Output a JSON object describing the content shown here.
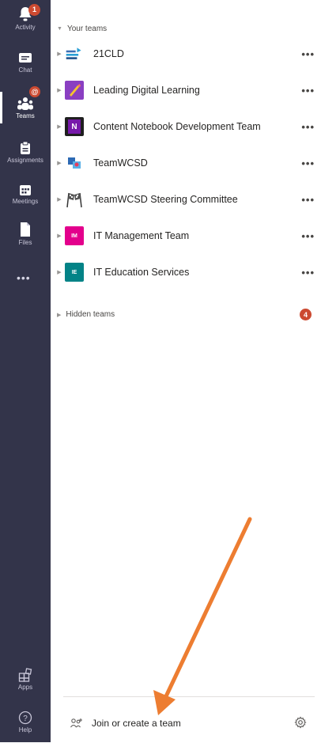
{
  "rail": {
    "items": [
      {
        "label": "Activity",
        "icon": "bell-icon",
        "badge": "1"
      },
      {
        "label": "Chat",
        "icon": "chat-icon"
      },
      {
        "label": "Teams",
        "icon": "teams-icon",
        "badge": "@",
        "active": true
      },
      {
        "label": "Assignments",
        "icon": "assignments-icon"
      },
      {
        "label": "Meetings",
        "icon": "calendar-icon"
      },
      {
        "label": "Files",
        "icon": "file-icon"
      },
      {
        "label": "Apps",
        "icon": "apps-icon"
      },
      {
        "label": "Help",
        "icon": "help-icon"
      }
    ],
    "more": "•••"
  },
  "your_teams": {
    "header": "Your teams",
    "teams": [
      {
        "name": "21CLD",
        "icon_text": "",
        "icon_color": "#3a6fb5"
      },
      {
        "name": "Leading Digital Learning",
        "icon_text": "",
        "icon_color": "#8a3fc2"
      },
      {
        "name": "Content Notebook Development Team",
        "icon_text": "N",
        "icon_color": "#7719aa"
      },
      {
        "name": "TeamWCSD",
        "icon_text": "",
        "icon_color": "#2d6ab4"
      },
      {
        "name": "TeamWCSD Steering Committee",
        "icon_text": "",
        "icon_color": "#555555"
      },
      {
        "name": "IT Management Team",
        "icon_text": "IM",
        "icon_color": "#e3008c"
      },
      {
        "name": "IT Education Services",
        "icon_text": "IE",
        "icon_color": "#038387"
      }
    ],
    "more_label": "•••"
  },
  "hidden_teams": {
    "label": "Hidden teams",
    "count": "4"
  },
  "footer": {
    "join_label": "Join or create a team"
  },
  "colors": {
    "rail": "#33344a",
    "badge": "#cc4a31",
    "arrow": "#ed7d31"
  }
}
